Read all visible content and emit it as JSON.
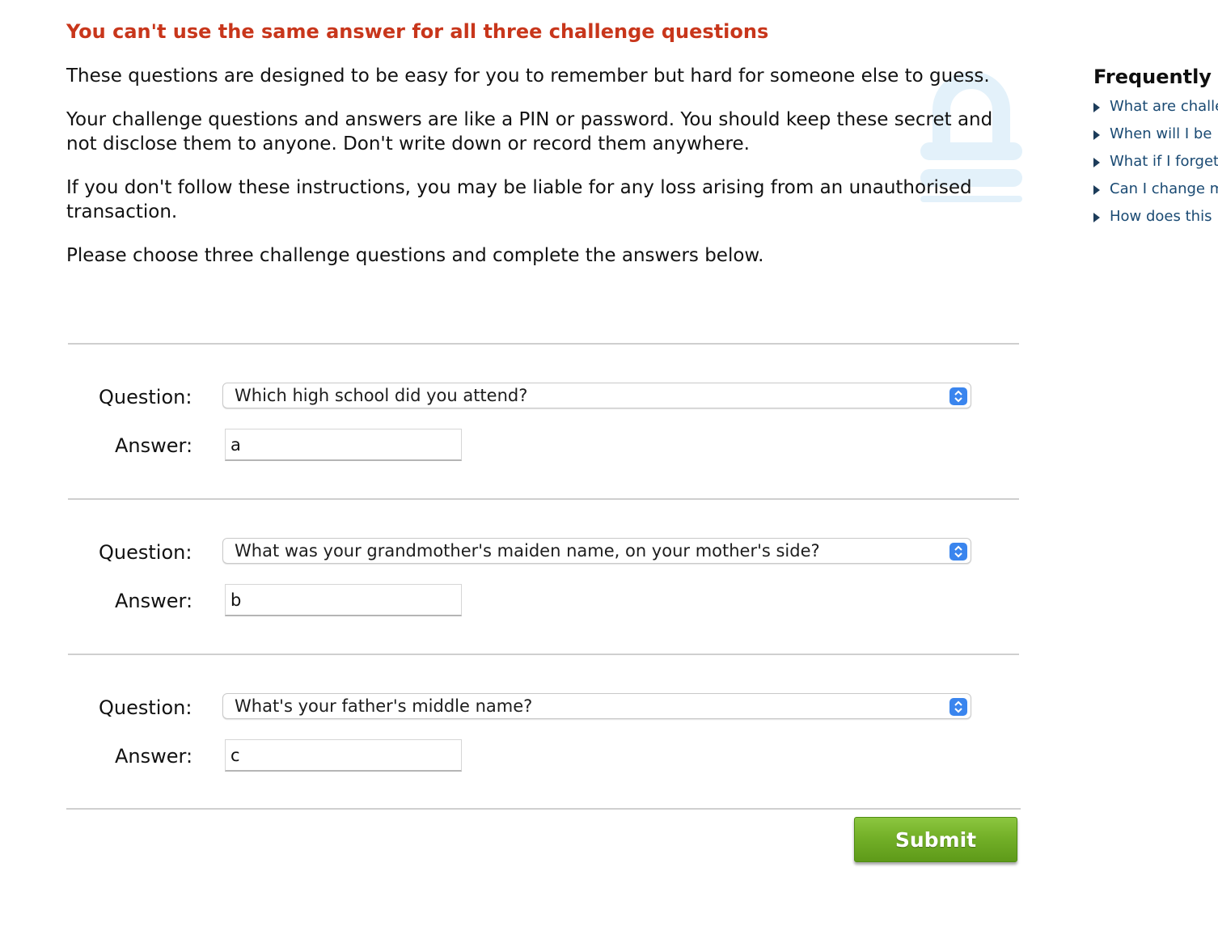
{
  "error": {
    "title": "You can't use the same answer for all three challenge questions"
  },
  "intro": {
    "paragraph1": "These questions are designed to be easy for you to remember but hard for someone else to guess.",
    "paragraph2": "Your challenge questions and answers are like a PIN or password. You should keep these secret and not disclose them to anyone. Don't write down or record them anywhere.",
    "paragraph3": "If you don't follow these instructions, you may be liable for any loss arising from an unauthorised transaction.",
    "paragraph4": "Please choose three challenge questions and complete the answers below."
  },
  "form": {
    "question_label": "Question:",
    "answer_label": "Answer:",
    "items": [
      {
        "question": "Which high school did you attend?",
        "answer": "a"
      },
      {
        "question": "What was your grandmother's maiden name, on your mother's side?",
        "answer": "b"
      },
      {
        "question": "What's your father's middle name?",
        "answer": "c"
      }
    ],
    "submit_label": "Submit"
  },
  "sidebar": {
    "title": "Frequently",
    "links": [
      "What are challe",
      "When will I be",
      "What if I forget",
      "Can I change m",
      "How does this"
    ]
  },
  "colors": {
    "error_red": "#c8361b",
    "link_blue": "#1a4a73",
    "submit_green": "#73b028",
    "select_arrow_blue": "#3a85ee",
    "lock_watermark": "#e3f1fa"
  },
  "icons": {
    "watermark": "padlock-icon",
    "select_arrows": "chevron-up-down-icon",
    "faq_bullet": "triangle-right-icon"
  }
}
